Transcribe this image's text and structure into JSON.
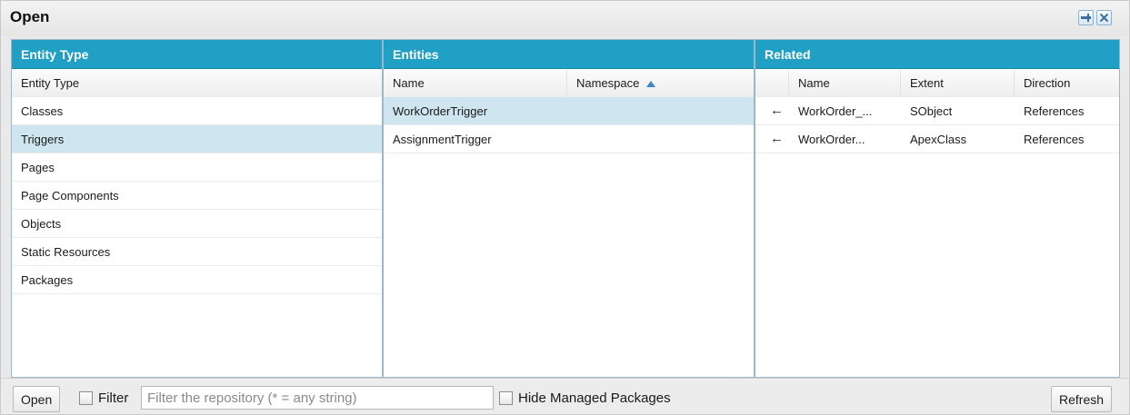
{
  "window": {
    "title": "Open",
    "pin_icon": "pin-icon",
    "close_icon": "close-icon"
  },
  "entity_type_panel": {
    "title": "Entity Type",
    "column": "Entity Type",
    "items": [
      "Classes",
      "Triggers",
      "Pages",
      "Page Components",
      "Objects",
      "Static Resources",
      "Packages"
    ],
    "selected": "Triggers"
  },
  "entities_panel": {
    "title": "Entities",
    "columns": {
      "name": "Name",
      "namespace": "Namespace",
      "sort_icon": "sort-ascending-icon"
    },
    "rows": [
      {
        "name": "WorkOrderTrigger",
        "namespace": ""
      },
      {
        "name": "AssignmentTrigger",
        "namespace": ""
      }
    ],
    "selected": "WorkOrderTrigger"
  },
  "related_panel": {
    "title": "Related",
    "columns": {
      "name": "Name",
      "extent": "Extent",
      "direction": "Direction"
    },
    "rows": [
      {
        "arrow": "←",
        "name": "WorkOrder_...",
        "extent": "SObject",
        "direction": "References"
      },
      {
        "arrow": "←",
        "name": "WorkOrder...",
        "extent": "ApexClass",
        "direction": "References"
      }
    ]
  },
  "footer": {
    "open_label": "Open",
    "filter_label": "Filter",
    "filter_placeholder": "Filter the repository (* = any string)",
    "filter_value": "",
    "hide_managed_label": "Hide Managed Packages",
    "refresh_label": "Refresh"
  },
  "colors": {
    "header_blue": "#21a0c6",
    "selected_row": "#cfe6f0"
  }
}
